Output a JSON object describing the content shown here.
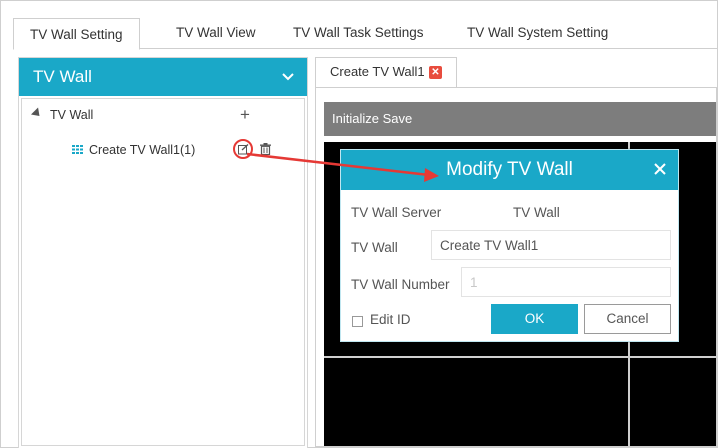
{
  "top_tabs": [
    {
      "label": "TV Wall Setting",
      "active": true
    },
    {
      "label": "TV Wall View",
      "active": false
    },
    {
      "label": "TV Wall Task Settings",
      "active": false
    },
    {
      "label": "TV Wall System Setting",
      "active": false
    }
  ],
  "left_panel": {
    "title": "TV Wall",
    "tree": {
      "root_label": "TV Wall",
      "child_label": "Create TV Wall1(1)"
    }
  },
  "doc_tab": {
    "label": "Create TV Wall1"
  },
  "toolbar": {
    "initialize_label": "Initialize",
    "save_label": "Save"
  },
  "modal": {
    "title": "Modify TV Wall",
    "server_label": "TV Wall Server",
    "server_value": "TV Wall",
    "name_label": "TV Wall",
    "name_value": "Create TV Wall1",
    "number_label": "TV Wall Number",
    "number_value": "1",
    "edit_id_label": "Edit ID",
    "ok_label": "OK",
    "cancel_label": "Cancel"
  },
  "colors": {
    "accent": "#1aa8c8",
    "annotation": "#e53935",
    "toolbar": "#7d7d7d",
    "close_tab": "#e84c3d"
  }
}
